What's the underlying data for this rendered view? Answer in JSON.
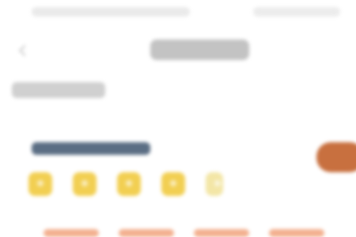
{
  "status_bar": {
    "time": "",
    "signal": ""
  },
  "header": {
    "back_icon": "chevron-left-icon",
    "title": ""
  },
  "section": {
    "title": ""
  },
  "rating_card": {
    "title": "",
    "rating": {
      "value": 4,
      "out_of": 5
    },
    "star_icon": "star-icon"
  },
  "cta": {
    "label": ""
  },
  "bottom": {
    "items": [
      "",
      "",
      "",
      "",
      ""
    ]
  },
  "colors": {
    "accent": "#c8703f",
    "star": "#f2cf52",
    "star_empty": "#f3e6a6",
    "text_dark": "#5b6e84",
    "bottom_highlight": "#f3b08f"
  }
}
